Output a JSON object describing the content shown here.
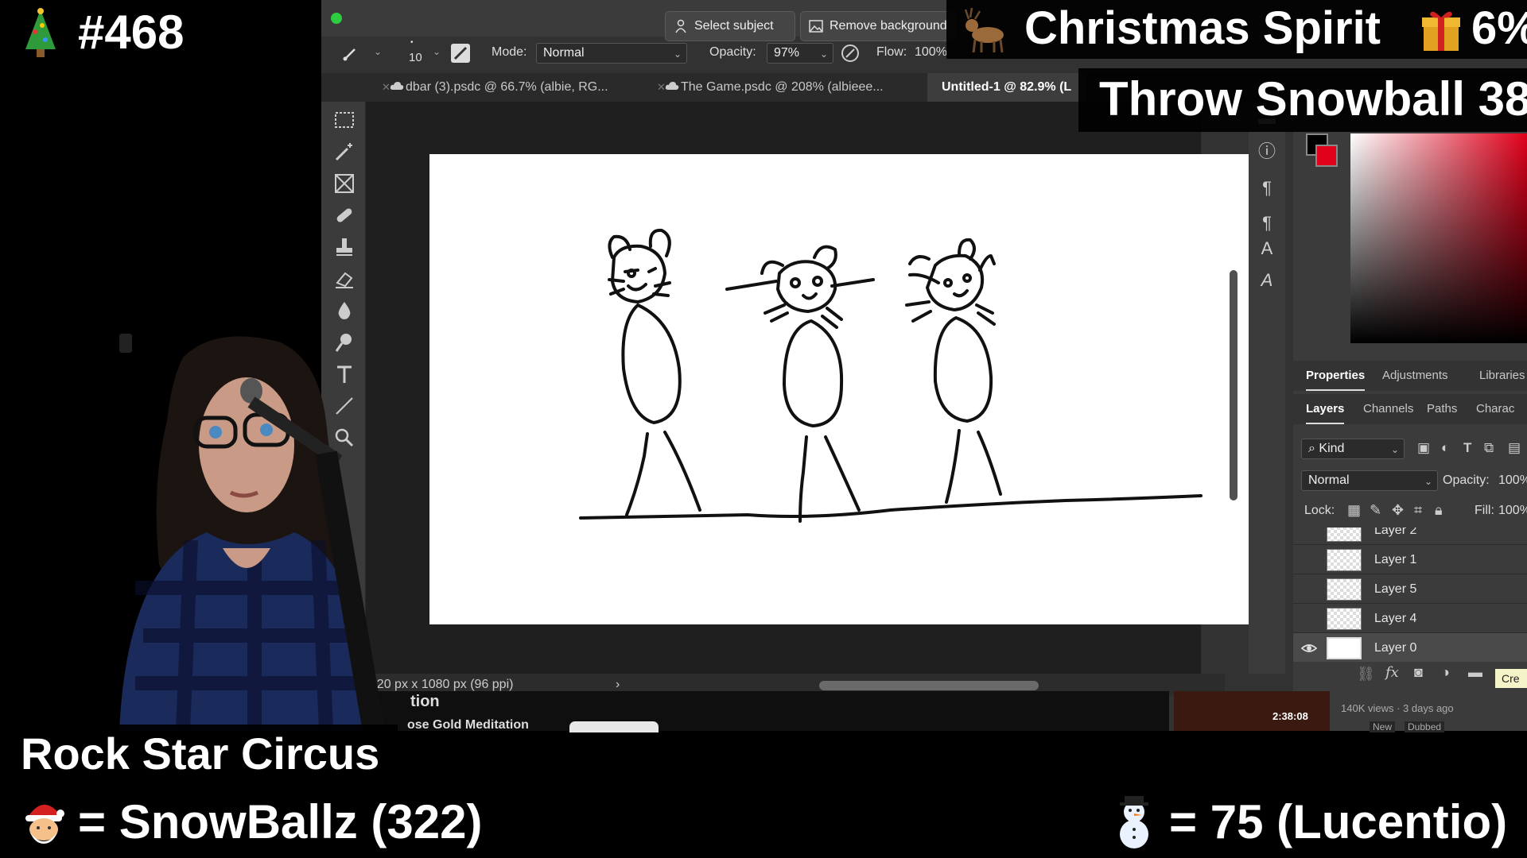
{
  "photoshop": {
    "title_buttons": {
      "select_subject": "Select subject",
      "remove_background": "Remove background"
    },
    "options_bar": {
      "brush_size": "10",
      "mode_label": "Mode:",
      "mode_value": "Normal",
      "opacity_label": "Opacity:",
      "opacity_value": "97%",
      "flow_label": "Flow:",
      "flow_value": "100%"
    },
    "document_tabs": [
      {
        "label": "dbar (3).psdc @ 66.7% (albie, RG..."
      },
      {
        "label": "The Game.psdc @ 208% (albieee..."
      },
      {
        "label": "Untitled-1 @ 82.9% (L"
      }
    ],
    "status_bar": {
      "zoom_fragment": "%",
      "dimensions": "1920 px x 1080 px (96 ppi)",
      "arrow": "›"
    },
    "panel_tabs_top": [
      "Properties",
      "Adjustments",
      "Libraries"
    ],
    "panel_tabs_layers": [
      "Layers",
      "Channels",
      "Paths",
      "Charac"
    ],
    "layers_panel": {
      "kind_label": "Kind",
      "blend_mode": "Normal",
      "opacity_label": "Opacity:",
      "opacity_value": "100%",
      "lock_label": "Lock:",
      "fill_label": "Fill:",
      "fill_value": "100%",
      "layers": [
        {
          "name": "Layer 2",
          "visible": false,
          "selected": false
        },
        {
          "name": "Layer 1",
          "visible": false,
          "selected": false
        },
        {
          "name": "Layer 5",
          "visible": false,
          "selected": false
        },
        {
          "name": "Layer 4",
          "visible": false,
          "selected": false
        },
        {
          "name": "Layer 0",
          "visible": true,
          "selected": true
        }
      ],
      "tooltip_fragment": "Cre"
    },
    "colors": {
      "foreground": "#000000",
      "background": "#e0001a",
      "accent_green": "#2ecc40"
    }
  },
  "youtube_strip": {
    "fragment_1": "tion",
    "fragment_2": "ose Gold Meditation",
    "duration": "2:38:08",
    "views": "140K views · 3 days ago",
    "badge_new": "New",
    "badge_dubbed": "Dubbed"
  },
  "overlays": {
    "counter": "#468",
    "christmas_spirit": "Christmas Spirit",
    "spirit_percent": "6%",
    "throw_snowball": "Throw Snowball 38",
    "streamer_name": "Rock Star Circus",
    "santa_line": "= SnowBallz (322)",
    "snowman_line": "=  75 (Lucentio)"
  },
  "icons": [
    "tree-icon",
    "reindeer-icon",
    "gift-icon",
    "santa-icon",
    "snowman-icon",
    "brush-icon",
    "marquee-icon",
    "magic-wand-icon",
    "frame-icon",
    "healing-icon",
    "stamp-icon",
    "eraser-icon",
    "blur-icon",
    "dodge-icon",
    "type-icon",
    "line-icon",
    "zoom-icon",
    "eye-icon",
    "info-icon",
    "paragraph-icon"
  ]
}
